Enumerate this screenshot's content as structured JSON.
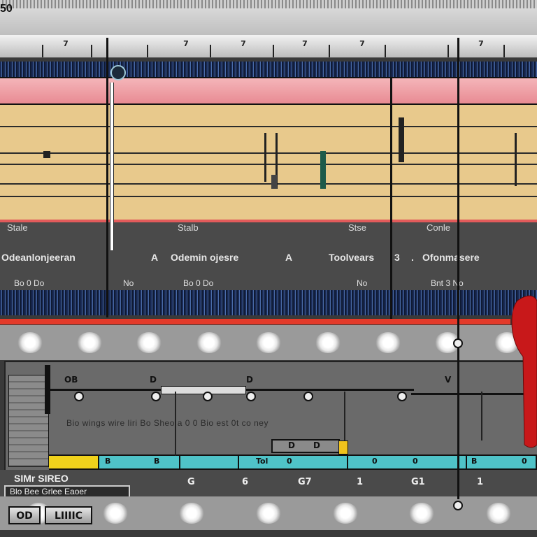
{
  "header": {
    "title": "50"
  },
  "ruler": {
    "labels": [
      "7",
      "7",
      "7",
      "7",
      "7",
      "7"
    ]
  },
  "tracks": {
    "labels": [
      "Stale",
      "Stalb",
      "Stse",
      "Conle"
    ],
    "details": [
      "Odeanlonjeeran",
      "Odemin ojesre",
      "Toolvears",
      "Ofonmasere"
    ],
    "detail_markers": [
      "A",
      "A",
      "3",
      "."
    ],
    "meta": [
      "Bo 0 Do",
      "No",
      "Bo 0 Do",
      "No",
      "Bnt 3 No"
    ]
  },
  "timeline": {
    "clip_labels": [
      "OB",
      "D",
      "D",
      "V"
    ],
    "caption": "Bio wings wire  liri  Bo Sheo    a  0 0  Bio est 0t  co  ney",
    "center_buttons": [
      "D",
      "D"
    ]
  },
  "lane": {
    "labels": [
      "B",
      "B",
      "Tol",
      "0",
      "0",
      "0",
      "B",
      "0"
    ]
  },
  "bottom": {
    "status": "SIMr SIREO",
    "status_panel": "Blo Bee Grlee Eaoer",
    "markers": [
      "G",
      "6",
      "G7",
      "1",
      "G1",
      "1"
    ],
    "stop_label": "OD",
    "mode_label": "LIIIIC"
  },
  "colors": {
    "accent_red": "#e33a2a",
    "track_tan": "#e8c98c",
    "region_pink": "#f4b5b9",
    "lane_cyan": "#4fc3c8",
    "wave_blue": "#1a2b57"
  }
}
